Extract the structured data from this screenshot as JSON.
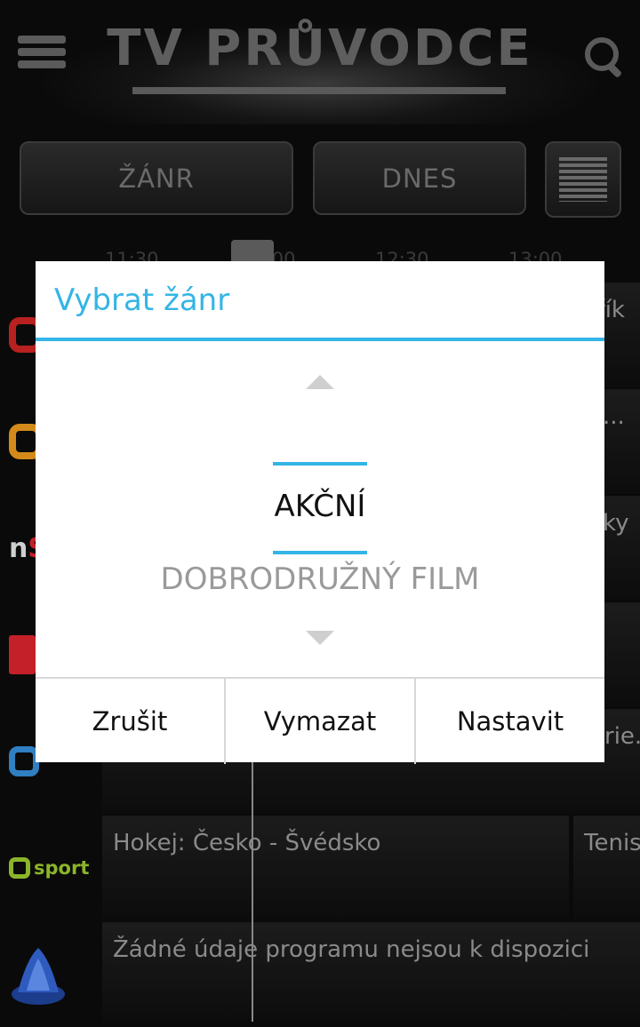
{
  "header": {
    "title": "TV PRŮVODCE",
    "menu_icon": "hamburger-menu-icon",
    "search_icon": "search-icon"
  },
  "filters": {
    "genre_label": "ŽÁNR",
    "day_label": "DNES",
    "list_icon": "list-view-icon"
  },
  "timeline": [
    "11:30",
    "12:00",
    "12:30",
    "13:00"
  ],
  "rows": [
    {
      "edge_text": "řík"
    },
    {
      "edge_text": "..."
    },
    {
      "edge_text": "ky"
    },
    {
      "edge_text": ""
    },
    {
      "edge_text": "rie.c"
    },
    {
      "logo_text": "sport",
      "program": "Hokej: Česko - Švédsko",
      "next": "Tenis"
    },
    {
      "program": "Žádné údaje programu nejsou k dispozici"
    }
  ],
  "dialog": {
    "title": "Vybrat žánr",
    "current": "AKČNÍ",
    "next": "DOBRODRUŽNÝ FILM",
    "buttons": {
      "cancel": "Zrušit",
      "clear": "Vymazat",
      "set": "Nastavit"
    }
  },
  "colors": {
    "accent": "#33b5e5",
    "background": "#0a0a0a"
  }
}
